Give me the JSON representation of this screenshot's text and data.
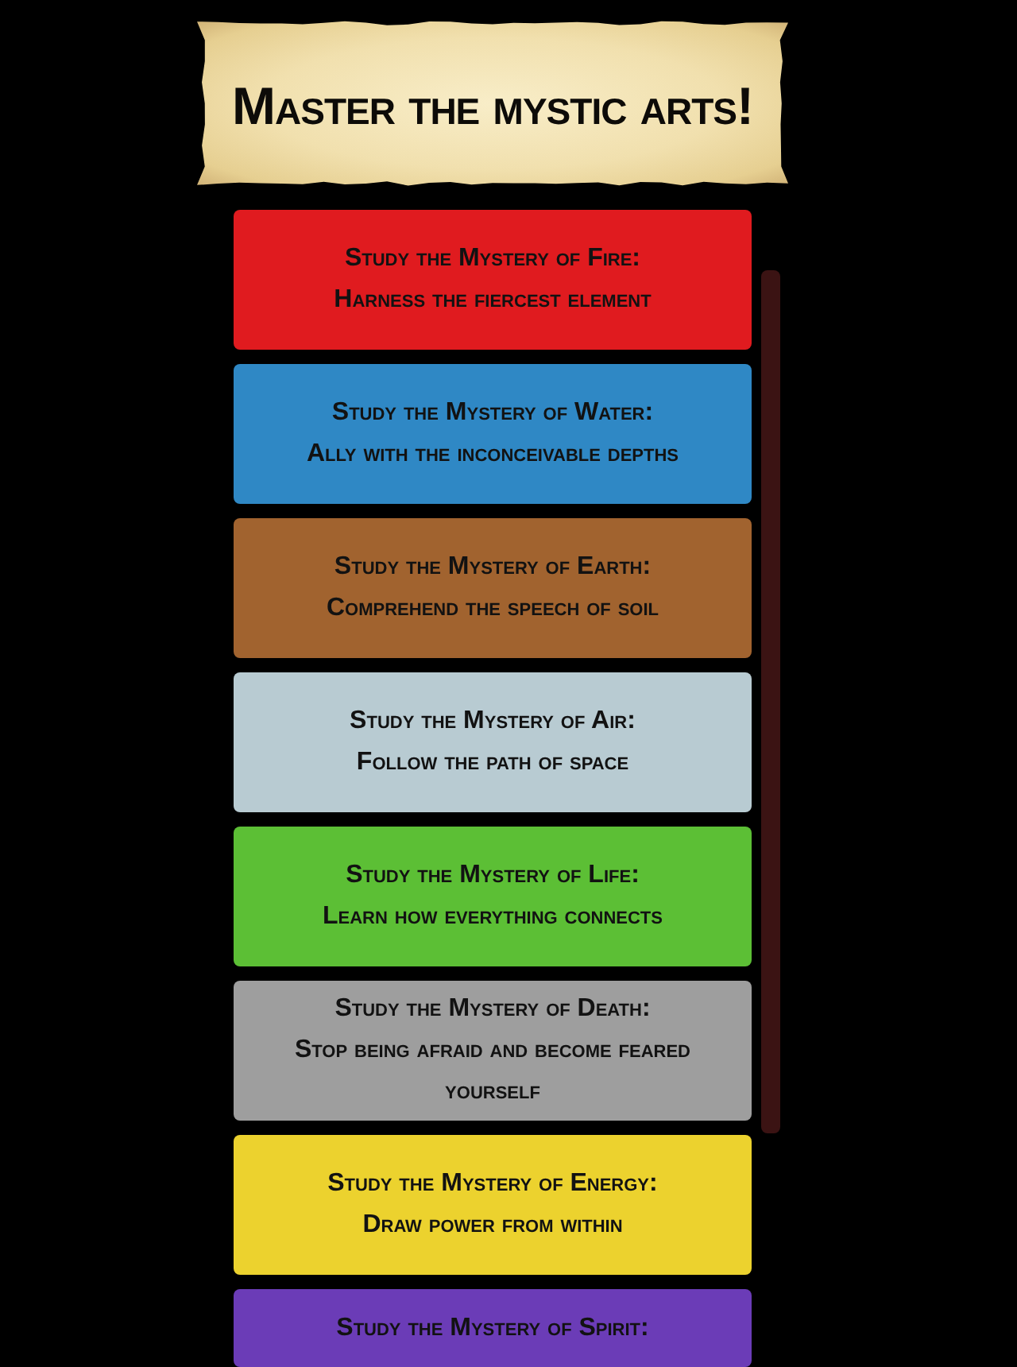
{
  "banner": {
    "title": "Master the mystic arts!"
  },
  "cards": [
    {
      "title": "Study the Mystery of Fire:",
      "subtitle": "Harness the fiercest element",
      "color": "#e01b1f"
    },
    {
      "title": "Study the Mystery of Water:",
      "subtitle": "Ally with the inconceivable depths",
      "color": "#2f88c5"
    },
    {
      "title": "Study the Mystery of Earth:",
      "subtitle": "Comprehend the speech of soil",
      "color": "#a1632f"
    },
    {
      "title": "Study the Mystery of Air:",
      "subtitle": "Follow the path of space",
      "color": "#b8cbd2"
    },
    {
      "title": "Study the Mystery of Life:",
      "subtitle": "Learn how everything connects",
      "color": "#5cbf35"
    },
    {
      "title": "Study the Mystery of Death:",
      "subtitle": "Stop being afraid and become feared yourself",
      "color": "#9e9e9e"
    },
    {
      "title": "Study the Mystery of Energy:",
      "subtitle": "Draw power from within",
      "color": "#ecd22e"
    },
    {
      "title": "Study the Mystery of Spirit:",
      "color": "#6b3cb7"
    }
  ]
}
